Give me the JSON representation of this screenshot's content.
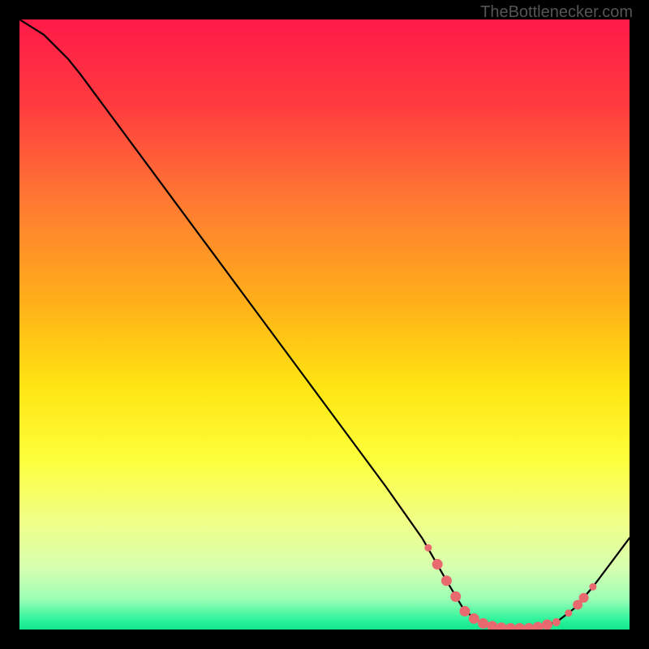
{
  "watermark": "TheBottlenecker.com",
  "chart_data": {
    "type": "line",
    "title": "",
    "xlabel": "",
    "ylabel": "",
    "xlim": [
      0,
      100
    ],
    "ylim": [
      0,
      100
    ],
    "background_gradient": {
      "stops": [
        {
          "offset": 0.0,
          "color": "#ff1a48"
        },
        {
          "offset": 0.14,
          "color": "#ff3b3f"
        },
        {
          "offset": 0.3,
          "color": "#ff7a32"
        },
        {
          "offset": 0.47,
          "color": "#ffb218"
        },
        {
          "offset": 0.6,
          "color": "#ffe412"
        },
        {
          "offset": 0.72,
          "color": "#fdff3a"
        },
        {
          "offset": 0.82,
          "color": "#f1ff86"
        },
        {
          "offset": 0.9,
          "color": "#d6ffb0"
        },
        {
          "offset": 0.95,
          "color": "#9cffb5"
        },
        {
          "offset": 0.985,
          "color": "#2bf39a"
        },
        {
          "offset": 1.0,
          "color": "#12e58e"
        }
      ]
    },
    "curve": [
      {
        "x": 0.0,
        "y": 100.0
      },
      {
        "x": 4.0,
        "y": 97.5
      },
      {
        "x": 8.0,
        "y": 93.5
      },
      {
        "x": 10.0,
        "y": 91.0
      },
      {
        "x": 20.0,
        "y": 77.5
      },
      {
        "x": 30.0,
        "y": 64.0
      },
      {
        "x": 40.0,
        "y": 50.5
      },
      {
        "x": 50.0,
        "y": 37.0
      },
      {
        "x": 60.0,
        "y": 23.5
      },
      {
        "x": 66.0,
        "y": 15.0
      },
      {
        "x": 70.0,
        "y": 8.0
      },
      {
        "x": 73.0,
        "y": 3.0
      },
      {
        "x": 76.0,
        "y": 1.0
      },
      {
        "x": 80.0,
        "y": 0.2
      },
      {
        "x": 84.0,
        "y": 0.2
      },
      {
        "x": 88.0,
        "y": 1.2
      },
      {
        "x": 91.0,
        "y": 3.5
      },
      {
        "x": 94.0,
        "y": 7.0
      },
      {
        "x": 97.0,
        "y": 11.0
      },
      {
        "x": 100.0,
        "y": 15.0
      }
    ],
    "curve_color": "#000000",
    "curve_width": 2.2,
    "markers": [
      {
        "x": 67.0,
        "y": 13.4,
        "r": 4.5
      },
      {
        "x": 68.5,
        "y": 10.7,
        "r": 6.5
      },
      {
        "x": 70.0,
        "y": 8.0,
        "r": 6.5
      },
      {
        "x": 71.5,
        "y": 5.4,
        "r": 6.5
      },
      {
        "x": 73.0,
        "y": 3.0,
        "r": 6.5
      },
      {
        "x": 74.5,
        "y": 1.8,
        "r": 6.5
      },
      {
        "x": 76.0,
        "y": 1.0,
        "r": 6.5
      },
      {
        "x": 77.5,
        "y": 0.55,
        "r": 6.5
      },
      {
        "x": 79.0,
        "y": 0.3,
        "r": 6.5
      },
      {
        "x": 80.5,
        "y": 0.2,
        "r": 6.5
      },
      {
        "x": 82.0,
        "y": 0.2,
        "r": 6.5
      },
      {
        "x": 83.5,
        "y": 0.2,
        "r": 6.5
      },
      {
        "x": 85.0,
        "y": 0.4,
        "r": 6.5
      },
      {
        "x": 86.5,
        "y": 0.8,
        "r": 6.5
      },
      {
        "x": 88.0,
        "y": 1.2,
        "r": 5.0
      },
      {
        "x": 90.0,
        "y": 2.7,
        "r": 4.5
      },
      {
        "x": 91.5,
        "y": 4.05,
        "r": 6.0
      },
      {
        "x": 92.5,
        "y": 5.2,
        "r": 6.0
      },
      {
        "x": 94.0,
        "y": 7.0,
        "r": 4.5
      }
    ],
    "marker_color": "#e86a6f"
  }
}
